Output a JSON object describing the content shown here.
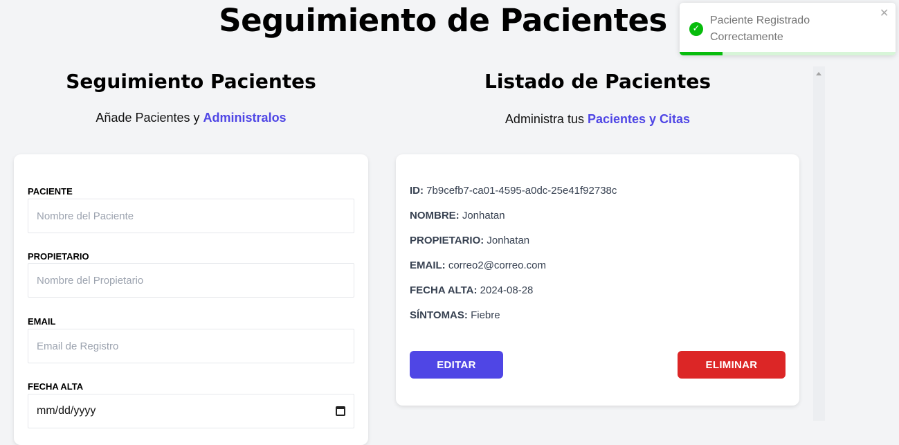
{
  "header": {
    "title": "Seguimiento de Pacientes"
  },
  "form_section": {
    "title": "Seguimiento Pacientes",
    "subtitle_prefix": "Añade Pacientes y",
    "subtitle_accent": "Administralos",
    "fields": {
      "paciente": {
        "label": "PACIENTE",
        "placeholder": "Nombre del Paciente",
        "value": ""
      },
      "propietario": {
        "label": "PROPIETARIO",
        "placeholder": "Nombre del Propietario",
        "value": ""
      },
      "email": {
        "label": "EMAIL",
        "placeholder": "Email de Registro",
        "value": ""
      },
      "fecha_alta": {
        "label": "FECHA ALTA",
        "value": "mm/dd/yyyy"
      }
    }
  },
  "list_section": {
    "title": "Listado de Pacientes",
    "subtitle_prefix": "Administra tus",
    "subtitle_accent": "Pacientes y Citas",
    "patients": [
      {
        "id_label": "ID:",
        "id": "7b9cefb7-ca01-4595-a0dc-25e41f92738c",
        "nombre_label": "NOMBRE:",
        "nombre": "Jonhatan",
        "propietario_label": "PROPIETARIO:",
        "propietario": "Jonhatan",
        "email_label": "EMAIL:",
        "email": "correo2@correo.com",
        "fecha_label": "FECHA ALTA:",
        "fecha": "2024-08-28",
        "sintomas_label": "SÍNTOMAS:",
        "sintomas": "Fiebre",
        "edit_label": "EDITAR",
        "delete_label": "ELIMINAR"
      }
    ]
  },
  "toast": {
    "message": "Paciente Registrado Correctamente",
    "icon": "check-circle-icon",
    "close_icon": "close-icon",
    "progress": 0.2
  },
  "colors": {
    "accent": "#4f46e5",
    "danger": "#dc2626",
    "success": "#07bc0c",
    "background": "#f3f4f6"
  }
}
